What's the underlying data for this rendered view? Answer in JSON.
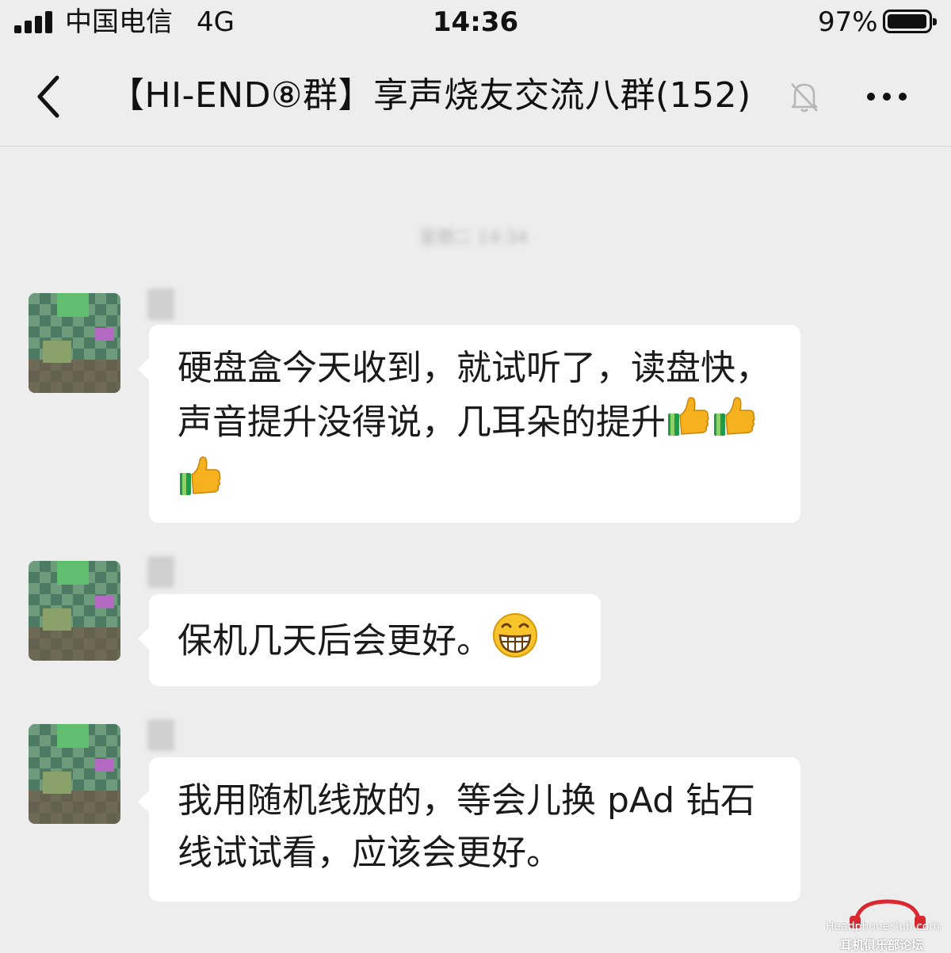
{
  "status_bar": {
    "carrier": "中国电信",
    "network": "4G",
    "time": "14:36",
    "battery": "97%",
    "battery_level": 0.97
  },
  "nav": {
    "title": "【HI-END⑧群】享声烧友交流八群(152)",
    "icons": {
      "back": "chevron-left-icon",
      "mute": "bell-muted-icon",
      "more": "ellipsis-icon"
    }
  },
  "chat": {
    "time_divider": "星期二 14:34",
    "messages": [
      {
        "sender": "某",
        "text": "硬盘盒今天收到，就试听了，读盘快，声音提升没得说，几耳朵的提升",
        "emoji": [
          "thumbs-up",
          "thumbs-up",
          "thumbs-up"
        ]
      },
      {
        "sender": "某",
        "text": "保机几天后会更好。",
        "emoji": [
          "grin"
        ]
      },
      {
        "sender": "某",
        "text": "我用随机线放的，等会儿换 pAd 钻石线试试看，应该会更好。",
        "emoji": []
      }
    ]
  },
  "watermark": {
    "line1": "Headphoneclub.com",
    "line2": "耳机俱乐部论坛"
  },
  "colors": {
    "background": "#ededed",
    "bubble": "#ffffff",
    "text": "#111111",
    "watermark_red": "#d9282f"
  }
}
